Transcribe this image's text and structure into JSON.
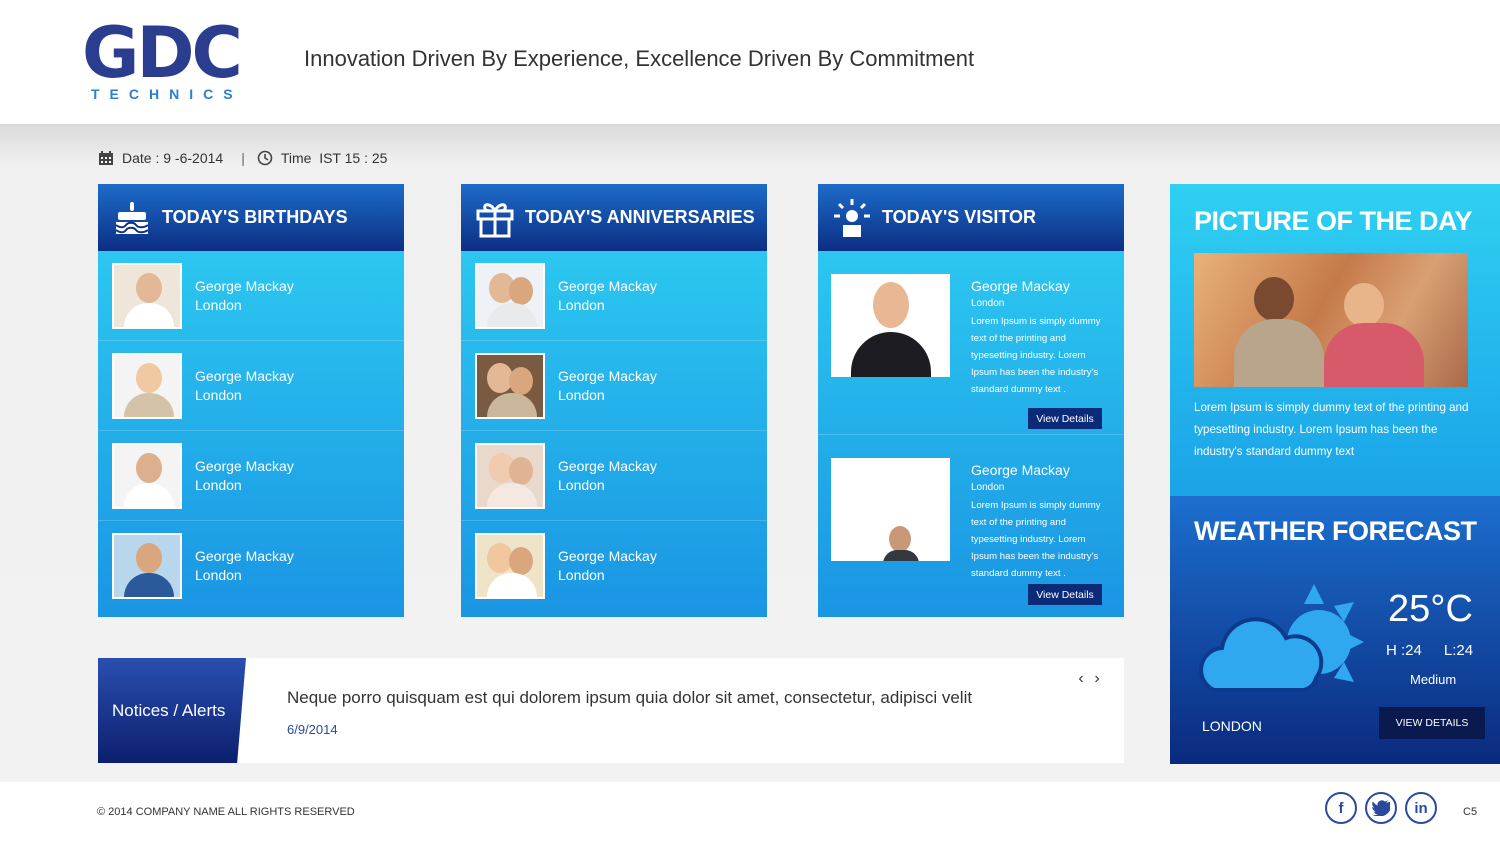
{
  "header": {
    "logo_big": "GDC",
    "logo_small": "TECHNICS",
    "tagline": "Innovation Driven By Experience, Excellence Driven By Commitment"
  },
  "datetime": {
    "date_label": "Date :",
    "date_value": "9 -6-2014",
    "separator": "|",
    "time_label": "Time",
    "time_value": "IST 15 : 25"
  },
  "birthdays": {
    "title": "TODAY'S BIRTHDAYS",
    "icon": "cake-icon",
    "items": [
      {
        "name": "George Mackay",
        "city": "London"
      },
      {
        "name": "George Mackay",
        "city": "London"
      },
      {
        "name": "George Mackay",
        "city": "London"
      },
      {
        "name": "George Mackay",
        "city": "London"
      }
    ]
  },
  "anniversaries": {
    "title": "TODAY'S ANNIVERSARIES",
    "icon": "gift-icon",
    "items": [
      {
        "name": "George Mackay",
        "city": "London"
      },
      {
        "name": "George Mackay",
        "city": "London"
      },
      {
        "name": "George Mackay",
        "city": "London"
      },
      {
        "name": "George Mackay",
        "city": "London"
      }
    ]
  },
  "visitors": {
    "title": "TODAY'S VISITOR",
    "icon": "siren-icon",
    "items": [
      {
        "name": "George Mackay",
        "city": "London",
        "desc": "Lorem Ipsum is simply dummy text of the printing and typesetting industry. Lorem Ipsum has been the industry's standard dummy text .",
        "button": "View Details"
      },
      {
        "name": "George Mackay",
        "city": "London",
        "desc": "Lorem Ipsum is simply dummy text of the printing and typesetting industry. Lorem Ipsum has been the industry's standard dummy text .",
        "button": "View Details"
      }
    ]
  },
  "picture_of_day": {
    "title": "PICTURE OF THE DAY",
    "text": "Lorem Ipsum is simply dummy text of the printing and typesetting industry. Lorem Ipsum has been the industry's standard dummy text"
  },
  "weather": {
    "title": "WEATHER FORECAST",
    "temp": "25°C",
    "high": "H :24",
    "low": "L:24",
    "condition": "Medium",
    "city": "LONDON",
    "button": "VIEW DETAILS",
    "icon": "partly-cloudy-icon"
  },
  "notice": {
    "tab": "Notices / Alerts",
    "text": "Neque porro quisquam est qui dolorem ipsum quia dolor sit amet, consectetur, adipisci velit",
    "date": "6/9/2014",
    "prev": "‹",
    "next": "›"
  },
  "footer": {
    "copyright": "© 2014 COMPANY NAME ALL RIGHTS RESERVED",
    "version": "C5",
    "social": [
      "f",
      "t",
      "in"
    ]
  },
  "colors": {
    "brand": "#2a3d8f",
    "panel_top": "#2fd0f2",
    "panel_bottom": "#1a95e3",
    "header_dark": "#0c2e84"
  }
}
